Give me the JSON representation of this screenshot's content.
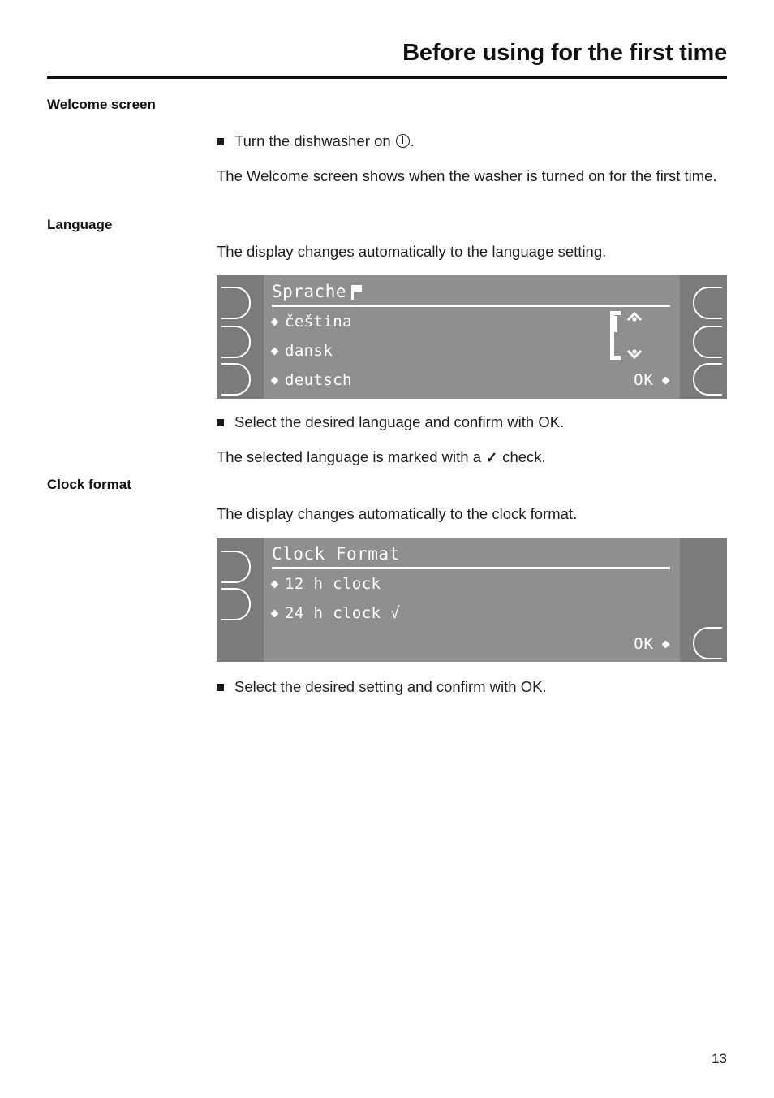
{
  "header": {
    "title": "Before using for the first time"
  },
  "sections": {
    "welcome": {
      "heading": "Welcome screen",
      "bullet": "Turn the dishwasher on",
      "bullet_icon": "power-icon",
      "bullet_suffix": ".",
      "paragraph": "The Welcome screen shows when the washer is turned on for the first time."
    },
    "language": {
      "heading": "Language",
      "intro": "The display changes automatically to the language setting.",
      "bullet": "Select the desired language and confirm with OK.",
      "note_before": "The selected language is marked with a",
      "note_icon": "check-icon",
      "note_after": "check."
    },
    "clock": {
      "heading": "Clock format",
      "intro": "The display changes automatically to the clock format.",
      "bullet": "Select the desired setting and confirm with OK."
    }
  },
  "displays": {
    "language_display": {
      "title": "Sprache",
      "title_icon": "flag-icon",
      "items": [
        {
          "label": "čeština"
        },
        {
          "label": "dansk"
        },
        {
          "label": "deutsch"
        }
      ],
      "ok_label": "OK",
      "left_buttons": 3,
      "right_buttons": 3,
      "scroll_icon": "scroll-up-down-icon",
      "colors": {
        "screen": "#8f8f8f",
        "band": "#7b7b7b",
        "text": "#ffffff"
      }
    },
    "clock_display": {
      "title": "Clock Format",
      "items": [
        {
          "label": "12 h clock",
          "checked": false
        },
        {
          "label": "24 h clock √",
          "checked": true
        }
      ],
      "ok_label": "OK",
      "left_buttons": 2,
      "right_buttons": 1,
      "colors": {
        "screen": "#8f8f8f",
        "band": "#7b7b7b",
        "text": "#ffffff"
      }
    }
  },
  "footer": {
    "page_number": "13"
  }
}
